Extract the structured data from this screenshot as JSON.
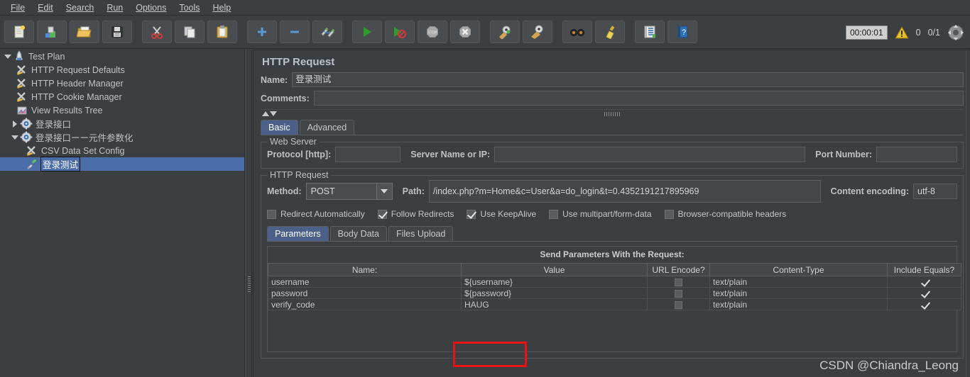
{
  "menu": {
    "items": [
      {
        "label": "File",
        "mnemonic": "F"
      },
      {
        "label": "Edit",
        "mnemonic": "E"
      },
      {
        "label": "Search",
        "mnemonic": "S"
      },
      {
        "label": "Run",
        "mnemonic": "R"
      },
      {
        "label": "Options",
        "mnemonic": "O"
      },
      {
        "label": "Tools",
        "mnemonic": "T"
      },
      {
        "label": "Help",
        "mnemonic": "H"
      }
    ]
  },
  "toolbar": {
    "buttons": [
      {
        "name": "new-icon",
        "title": "New"
      },
      {
        "name": "templates-icon",
        "title": "Templates"
      },
      {
        "name": "open-icon",
        "title": "Open"
      },
      {
        "name": "save-icon",
        "title": "Save"
      },
      {
        "name": "cut-icon",
        "title": "Cut"
      },
      {
        "name": "copy-icon",
        "title": "Copy"
      },
      {
        "name": "paste-icon",
        "title": "Paste"
      },
      {
        "name": "expand-all-icon",
        "title": "Expand All"
      },
      {
        "name": "collapse-all-icon",
        "title": "Collapse All"
      },
      {
        "name": "toggle-icon",
        "title": "Toggle"
      },
      {
        "name": "start-icon",
        "title": "Start"
      },
      {
        "name": "start-no-timers-icon",
        "title": "Start no pauses"
      },
      {
        "name": "stop-icon",
        "title": "Stop"
      },
      {
        "name": "shutdown-icon",
        "title": "Shutdown"
      },
      {
        "name": "clear-icon",
        "title": "Clear"
      },
      {
        "name": "clear-all-icon",
        "title": "Clear All"
      },
      {
        "name": "search-icon",
        "title": "Search"
      },
      {
        "name": "reset-search-icon",
        "title": "Reset Search"
      },
      {
        "name": "function-helper-icon",
        "title": "Function Helper Dialog"
      },
      {
        "name": "help-icon",
        "title": "Help"
      }
    ],
    "timer": "00:00:01",
    "warning_count": "0",
    "thread_count": "0/1"
  },
  "tree": {
    "nodes": [
      {
        "label": "Test Plan",
        "icon": "test-plan-icon",
        "toggle": "down",
        "indent": 0,
        "selected": false
      },
      {
        "label": "HTTP Request Defaults",
        "icon": "config-element-icon",
        "toggle": "none",
        "indent": 1,
        "selected": false
      },
      {
        "label": "HTTP Header Manager",
        "icon": "config-element-icon",
        "toggle": "none",
        "indent": 1,
        "selected": false
      },
      {
        "label": "HTTP Cookie Manager",
        "icon": "config-element-icon",
        "toggle": "none",
        "indent": 1,
        "selected": false
      },
      {
        "label": "View Results Tree",
        "icon": "listener-icon",
        "toggle": "none",
        "indent": 1,
        "selected": false
      },
      {
        "label": "登录接口",
        "icon": "thread-group-icon",
        "toggle": "right",
        "indent": 1,
        "selected": false
      },
      {
        "label": "登录接口ーー元件参数化",
        "icon": "thread-group-icon",
        "toggle": "down",
        "indent": 1,
        "selected": false
      },
      {
        "label": "CSV Data Set Config",
        "icon": "config-element-icon",
        "toggle": "none",
        "indent": 2,
        "selected": false
      },
      {
        "label": "登录测试",
        "icon": "http-sampler-icon",
        "toggle": "none",
        "indent": 2,
        "selected": true
      }
    ]
  },
  "editor": {
    "title": "HTTP Request",
    "name_label": "Name:",
    "name_value": "登录测试",
    "comments_label": "Comments:",
    "comments_value": "",
    "tabs": [
      {
        "label": "Basic",
        "active": true
      },
      {
        "label": "Advanced",
        "active": false
      }
    ],
    "web_server": {
      "group_title": "Web Server",
      "protocol_label": "Protocol [http]:",
      "protocol_value": "",
      "server_label": "Server Name or IP:",
      "server_value": "",
      "port_label": "Port Number:",
      "port_value": ""
    },
    "http_request": {
      "group_title": "HTTP Request",
      "method_label": "Method:",
      "method_value": "POST",
      "path_label": "Path:",
      "path_value": "/index.php?m=Home&c=User&a=do_login&t=0.4352191217895969",
      "encoding_label": "Content encoding:",
      "encoding_value": "utf-8",
      "checkboxes": [
        {
          "label": "Redirect Automatically",
          "checked": false
        },
        {
          "label": "Follow Redirects",
          "checked": true
        },
        {
          "label": "Use KeepAlive",
          "checked": true
        },
        {
          "label": "Use multipart/form-data",
          "checked": false
        },
        {
          "label": "Browser-compatible headers",
          "checked": false
        }
      ],
      "param_tabs": [
        {
          "label": "Parameters",
          "active": true
        },
        {
          "label": "Body Data",
          "active": false
        },
        {
          "label": "Files Upload",
          "active": false
        }
      ],
      "params": {
        "caption": "Send Parameters With the Request:",
        "columns": [
          "Name:",
          "Value",
          "URL Encode?",
          "Content-Type",
          "Include Equals?"
        ],
        "rows": [
          {
            "name": "username",
            "value": "${username}",
            "url_encode": false,
            "content_type": "text/plain",
            "include_equals": true
          },
          {
            "name": "password",
            "value": "${password}",
            "url_encode": false,
            "content_type": "text/plain",
            "include_equals": true
          },
          {
            "name": "verify_code",
            "value": "HAUG",
            "url_encode": false,
            "content_type": "text/plain",
            "include_equals": true
          }
        ]
      }
    }
  },
  "annotation": {
    "color": "#ee1111"
  },
  "watermark": "CSDN @Chiandra_Leong"
}
